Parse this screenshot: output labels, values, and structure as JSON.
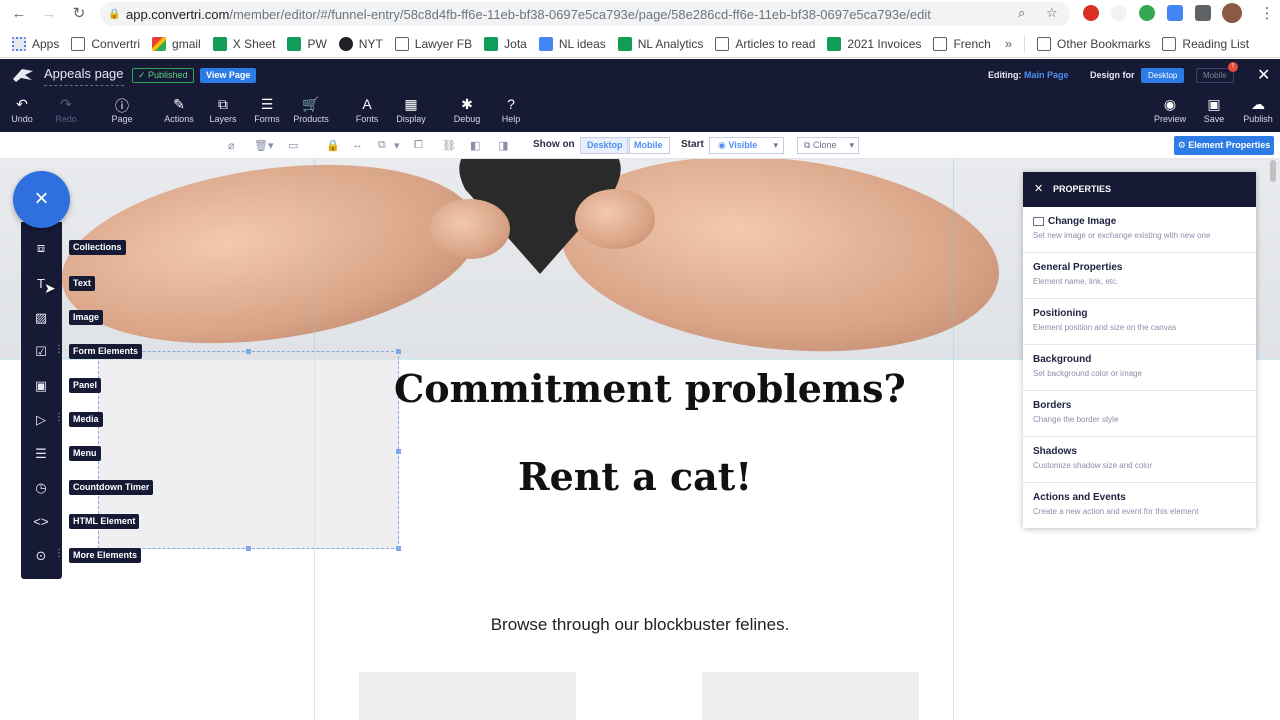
{
  "browser": {
    "url_host": "app.convertri.com",
    "url_path": "/member/editor/#/funnel-entry/58c8d4fb-ff6e-11eb-bf38-0697e5ca793e/page/58e286cd-ff6e-11eb-bf38-0697e5ca793e/edit",
    "bookmarks": [
      "Apps",
      "Convertri",
      "gmail",
      "X Sheet",
      "PW",
      "NYT",
      "Lawyer FB",
      "Jota",
      "NL ideas",
      "NL Analytics",
      "Articles to read",
      "2021 Invoices",
      "French"
    ],
    "bookmarks_more": "»",
    "other_bookmarks": "Other Bookmarks",
    "reading_list": "Reading List"
  },
  "app": {
    "page_name": "Appeals page",
    "published_badge": "✓ Published",
    "view_page": "View Page",
    "editing_label": "Editing:",
    "editing_value": "Main Page",
    "design_for": "Design for",
    "desktop": "Desktop",
    "mobile": "Mobile",
    "notif_count": "!",
    "toolbar": {
      "undo": "Undo",
      "redo": "Redo",
      "page": "Page",
      "actions": "Actions",
      "layers": "Layers",
      "forms": "Forms",
      "products": "Products",
      "fonts": "Fonts",
      "display": "Display",
      "debug": "Debug",
      "help": "Help",
      "preview": "Preview",
      "save": "Save",
      "publish": "Publish"
    }
  },
  "subbar": {
    "show_on": "Show on",
    "desktop": "Desktop",
    "mobile": "Mobile",
    "start": "Start",
    "visible": "◉ Visible",
    "clone": "Clone",
    "element_properties": "⚙ Element Properties"
  },
  "palette": {
    "close": "×",
    "items": [
      "Collections",
      "Text",
      "Image",
      "Form Elements",
      "Panel",
      "Media",
      "Menu",
      "Countdown Timer",
      "HTML Element",
      "More Elements"
    ]
  },
  "content": {
    "headline": "Commitment problems?",
    "subheadline": "Rent a cat!",
    "browse": "Browse through our blockbuster felines."
  },
  "properties": {
    "title": "PROPERTIES",
    "items": [
      {
        "title": "Change Image",
        "desc": "Set new image or exchange existing with new one"
      },
      {
        "title": "General Properties",
        "desc": "Element name, link, etc."
      },
      {
        "title": "Positioning",
        "desc": "Element position and size on the canvas"
      },
      {
        "title": "Background",
        "desc": "Set background color or image"
      },
      {
        "title": "Borders",
        "desc": "Change the border style"
      },
      {
        "title": "Shadows",
        "desc": "Customize shadow size and color"
      },
      {
        "title": "Actions and Events",
        "desc": "Create a new action and event for this element"
      }
    ]
  },
  "colors": {
    "header_bg": "#161a35",
    "accent_blue": "#2d7be5",
    "published_green": "#2ea44f"
  }
}
